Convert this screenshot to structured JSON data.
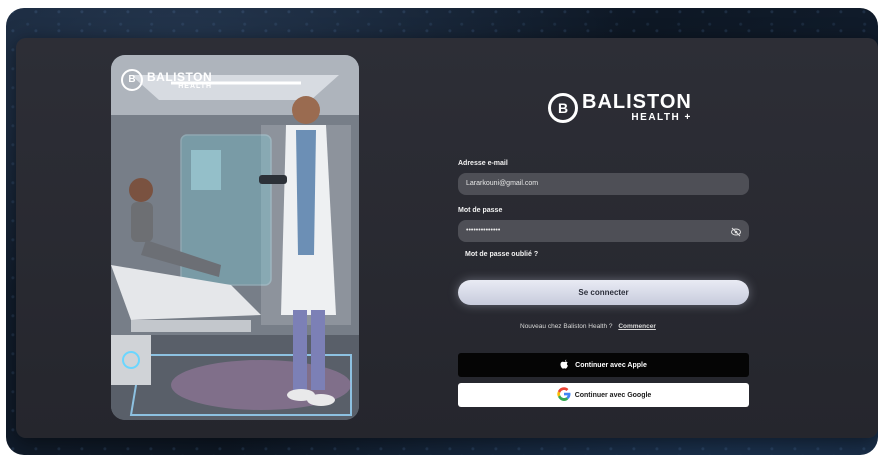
{
  "brand": {
    "name_line1": "BALISTON",
    "name_line2": "HEALTH",
    "mark_letter": "B",
    "plus_glyph": "+"
  },
  "form": {
    "email_label": "Adresse e-mail",
    "email_value": "Lararkouni@gmail.com",
    "password_label": "Mot de passe",
    "password_value": "••••••••••••••",
    "forgot_label": "Mot de passe oublié ?",
    "submit_label": "Se connecter"
  },
  "signup": {
    "text": "Nouveau chez Baliston Health ?",
    "link": "Commencer"
  },
  "social": {
    "apple_label": "Continuer avec Apple",
    "google_label": "Continuer avec Google"
  },
  "icons": {
    "eye": "eye-off-icon",
    "apple": "apple-icon",
    "google": "google-icon"
  },
  "colors": {
    "card_bg": "#2a2b32",
    "field_bg": "#4e4f56",
    "button_bg": "#dfe2ee",
    "apple_bg": "#050505",
    "google_bg": "#ffffff"
  }
}
